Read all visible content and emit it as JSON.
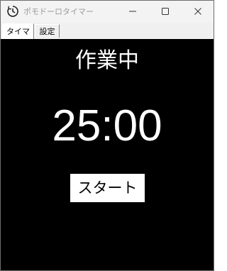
{
  "window": {
    "title": "ポモドーロタイマー",
    "icons": {
      "app": "timer-icon",
      "minimize": "minimize-icon",
      "maximize": "maximize-icon",
      "close": "close-icon"
    }
  },
  "tabs": [
    {
      "label": "タイマー",
      "selected": true
    },
    {
      "label": "設定",
      "selected": false
    }
  ],
  "timer": {
    "status": "作業中",
    "time": "25:00",
    "start_label": "スタート"
  },
  "colors": {
    "background": "#000000",
    "foreground": "#ffffff",
    "titlebar": "#f3f3f3"
  }
}
